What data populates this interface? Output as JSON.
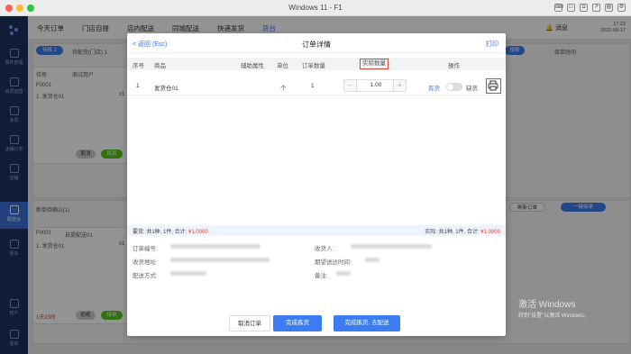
{
  "window": {
    "title": "Windows 11 - F1"
  },
  "nav": {
    "items": [
      "今天订单",
      "门店自提",
      "店内配送",
      "同城配送",
      "快递发货",
      "货台"
    ],
    "message": "消息",
    "time": "17:22",
    "date": "2022-08-17"
  },
  "sidebar": {
    "items": [
      "事件管理",
      "会员运营",
      "会员",
      "店铺订单",
      "店铺",
      "配送台",
      "更多",
      "帐户",
      "退出"
    ]
  },
  "background": {
    "tab_a": "待拣",
    "tab_a_count": "1",
    "tab_b": "待配货(门店)",
    "tab_b_count": "1",
    "search_btn": "搜索",
    "sort_label": "接单时间",
    "order1_status": "待拣",
    "order1_user": "测试用户",
    "order1_id": "F0001",
    "order1_item": "1. 发货仓01",
    "order1_qty": "x1",
    "cancel": "取消",
    "pick": "拣货",
    "section_title": "新单待确认(1)",
    "refresh": "刷新订单",
    "confirm_all": "一键接单",
    "order2_id": "F0001",
    "order2_type": "自提配送01",
    "order2_item": "1. 发货仓01",
    "order2_qty": "x1",
    "order2_time": "1天23时",
    "reject": "拒绝",
    "accept": "接单"
  },
  "modal": {
    "back": "< 返回 (Esc)",
    "title": "订单详情",
    "print": "打印",
    "columns": [
      "序号",
      "商品",
      "辅助属性",
      "单位",
      "订单数量",
      "实际数量",
      "操作"
    ],
    "row": {
      "index": "1",
      "product": "发货仓01",
      "unit": "个",
      "order_qty": "1",
      "actual_qty": "1.00",
      "in_stock": "有货",
      "out_of_stock": "缺货"
    },
    "summary": {
      "required_prefix": "要货: 共1种, 1件, 合计: ",
      "required_amount": "¥1.0000",
      "actual_prefix": "实际: 共1种, 1件, 合计: ",
      "actual_amount": "¥1.0000"
    },
    "info": {
      "order_no": "订单编号:",
      "recv_addr": "收货地址:",
      "delivery": "配送方式:",
      "receiver": "收货人:",
      "expected": "期望送达时间:",
      "remark": "备注:"
    },
    "buttons": {
      "cancel": "取消订单",
      "finish": "完成拣货",
      "finish_deliver": "完成拣货, 去配送"
    }
  },
  "watermark": {
    "line1": "激活 Windows",
    "line2": "转到\"设置\"以激活 Windows。"
  },
  "colors": {
    "primary": "#3b7df0",
    "sidebar": "#1e3360",
    "highlight": "#d9432f"
  }
}
